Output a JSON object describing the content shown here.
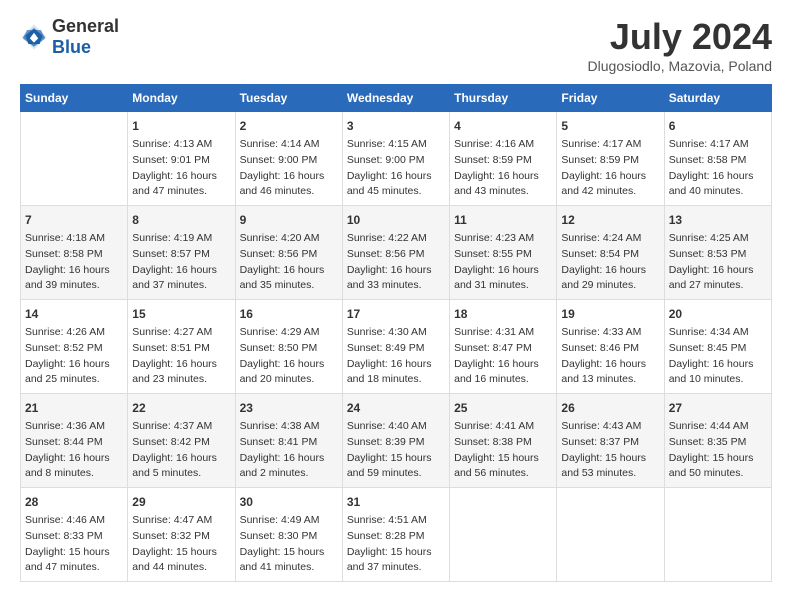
{
  "logo": {
    "text_general": "General",
    "text_blue": "Blue"
  },
  "title": "July 2024",
  "location": "Dlugosiodlo, Mazovia, Poland",
  "days_of_week": [
    "Sunday",
    "Monday",
    "Tuesday",
    "Wednesday",
    "Thursday",
    "Friday",
    "Saturday"
  ],
  "weeks": [
    [
      {
        "date": "",
        "info": ""
      },
      {
        "date": "1",
        "info": "Sunrise: 4:13 AM\nSunset: 9:01 PM\nDaylight: 16 hours and 47 minutes."
      },
      {
        "date": "2",
        "info": "Sunrise: 4:14 AM\nSunset: 9:00 PM\nDaylight: 16 hours and 46 minutes."
      },
      {
        "date": "3",
        "info": "Sunrise: 4:15 AM\nSunset: 9:00 PM\nDaylight: 16 hours and 45 minutes."
      },
      {
        "date": "4",
        "info": "Sunrise: 4:16 AM\nSunset: 8:59 PM\nDaylight: 16 hours and 43 minutes."
      },
      {
        "date": "5",
        "info": "Sunrise: 4:17 AM\nSunset: 8:59 PM\nDaylight: 16 hours and 42 minutes."
      },
      {
        "date": "6",
        "info": "Sunrise: 4:17 AM\nSunset: 8:58 PM\nDaylight: 16 hours and 40 minutes."
      }
    ],
    [
      {
        "date": "7",
        "info": "Sunrise: 4:18 AM\nSunset: 8:58 PM\nDaylight: 16 hours and 39 minutes."
      },
      {
        "date": "8",
        "info": "Sunrise: 4:19 AM\nSunset: 8:57 PM\nDaylight: 16 hours and 37 minutes."
      },
      {
        "date": "9",
        "info": "Sunrise: 4:20 AM\nSunset: 8:56 PM\nDaylight: 16 hours and 35 minutes."
      },
      {
        "date": "10",
        "info": "Sunrise: 4:22 AM\nSunset: 8:56 PM\nDaylight: 16 hours and 33 minutes."
      },
      {
        "date": "11",
        "info": "Sunrise: 4:23 AM\nSunset: 8:55 PM\nDaylight: 16 hours and 31 minutes."
      },
      {
        "date": "12",
        "info": "Sunrise: 4:24 AM\nSunset: 8:54 PM\nDaylight: 16 hours and 29 minutes."
      },
      {
        "date": "13",
        "info": "Sunrise: 4:25 AM\nSunset: 8:53 PM\nDaylight: 16 hours and 27 minutes."
      }
    ],
    [
      {
        "date": "14",
        "info": "Sunrise: 4:26 AM\nSunset: 8:52 PM\nDaylight: 16 hours and 25 minutes."
      },
      {
        "date": "15",
        "info": "Sunrise: 4:27 AM\nSunset: 8:51 PM\nDaylight: 16 hours and 23 minutes."
      },
      {
        "date": "16",
        "info": "Sunrise: 4:29 AM\nSunset: 8:50 PM\nDaylight: 16 hours and 20 minutes."
      },
      {
        "date": "17",
        "info": "Sunrise: 4:30 AM\nSunset: 8:49 PM\nDaylight: 16 hours and 18 minutes."
      },
      {
        "date": "18",
        "info": "Sunrise: 4:31 AM\nSunset: 8:47 PM\nDaylight: 16 hours and 16 minutes."
      },
      {
        "date": "19",
        "info": "Sunrise: 4:33 AM\nSunset: 8:46 PM\nDaylight: 16 hours and 13 minutes."
      },
      {
        "date": "20",
        "info": "Sunrise: 4:34 AM\nSunset: 8:45 PM\nDaylight: 16 hours and 10 minutes."
      }
    ],
    [
      {
        "date": "21",
        "info": "Sunrise: 4:36 AM\nSunset: 8:44 PM\nDaylight: 16 hours and 8 minutes."
      },
      {
        "date": "22",
        "info": "Sunrise: 4:37 AM\nSunset: 8:42 PM\nDaylight: 16 hours and 5 minutes."
      },
      {
        "date": "23",
        "info": "Sunrise: 4:38 AM\nSunset: 8:41 PM\nDaylight: 16 hours and 2 minutes."
      },
      {
        "date": "24",
        "info": "Sunrise: 4:40 AM\nSunset: 8:39 PM\nDaylight: 15 hours and 59 minutes."
      },
      {
        "date": "25",
        "info": "Sunrise: 4:41 AM\nSunset: 8:38 PM\nDaylight: 15 hours and 56 minutes."
      },
      {
        "date": "26",
        "info": "Sunrise: 4:43 AM\nSunset: 8:37 PM\nDaylight: 15 hours and 53 minutes."
      },
      {
        "date": "27",
        "info": "Sunrise: 4:44 AM\nSunset: 8:35 PM\nDaylight: 15 hours and 50 minutes."
      }
    ],
    [
      {
        "date": "28",
        "info": "Sunrise: 4:46 AM\nSunset: 8:33 PM\nDaylight: 15 hours and 47 minutes."
      },
      {
        "date": "29",
        "info": "Sunrise: 4:47 AM\nSunset: 8:32 PM\nDaylight: 15 hours and 44 minutes."
      },
      {
        "date": "30",
        "info": "Sunrise: 4:49 AM\nSunset: 8:30 PM\nDaylight: 15 hours and 41 minutes."
      },
      {
        "date": "31",
        "info": "Sunrise: 4:51 AM\nSunset: 8:28 PM\nDaylight: 15 hours and 37 minutes."
      },
      {
        "date": "",
        "info": ""
      },
      {
        "date": "",
        "info": ""
      },
      {
        "date": "",
        "info": ""
      }
    ]
  ]
}
